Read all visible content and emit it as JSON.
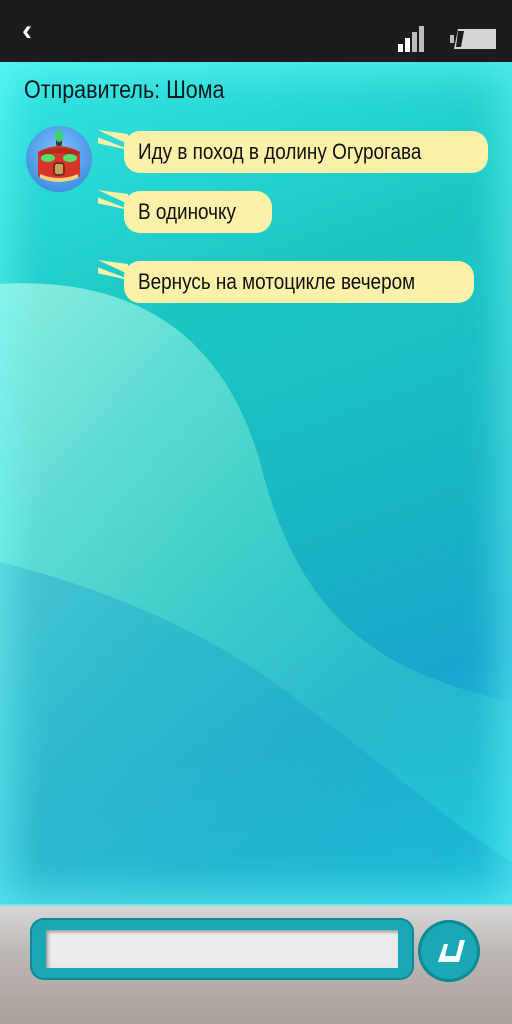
{
  "header": {
    "back_icon": "chevron-left-icon",
    "signal_icon": "signal-bars-icon",
    "battery_icon": "battery-low-icon"
  },
  "chat": {
    "sender_label": "Отправитель: Шома",
    "avatar_icon": "robot-avatar-icon",
    "messages": [
      {
        "text": "Иду в поход в долину Огурогава"
      },
      {
        "text": "В одиночку"
      },
      {
        "text": "Вернусь на мотоцикле вечером"
      }
    ],
    "bubble_color": "#fbf1a9"
  },
  "composer": {
    "input_value": "",
    "send_icon": "send-arrow-icon",
    "accent_color": "#1aa9b4"
  }
}
